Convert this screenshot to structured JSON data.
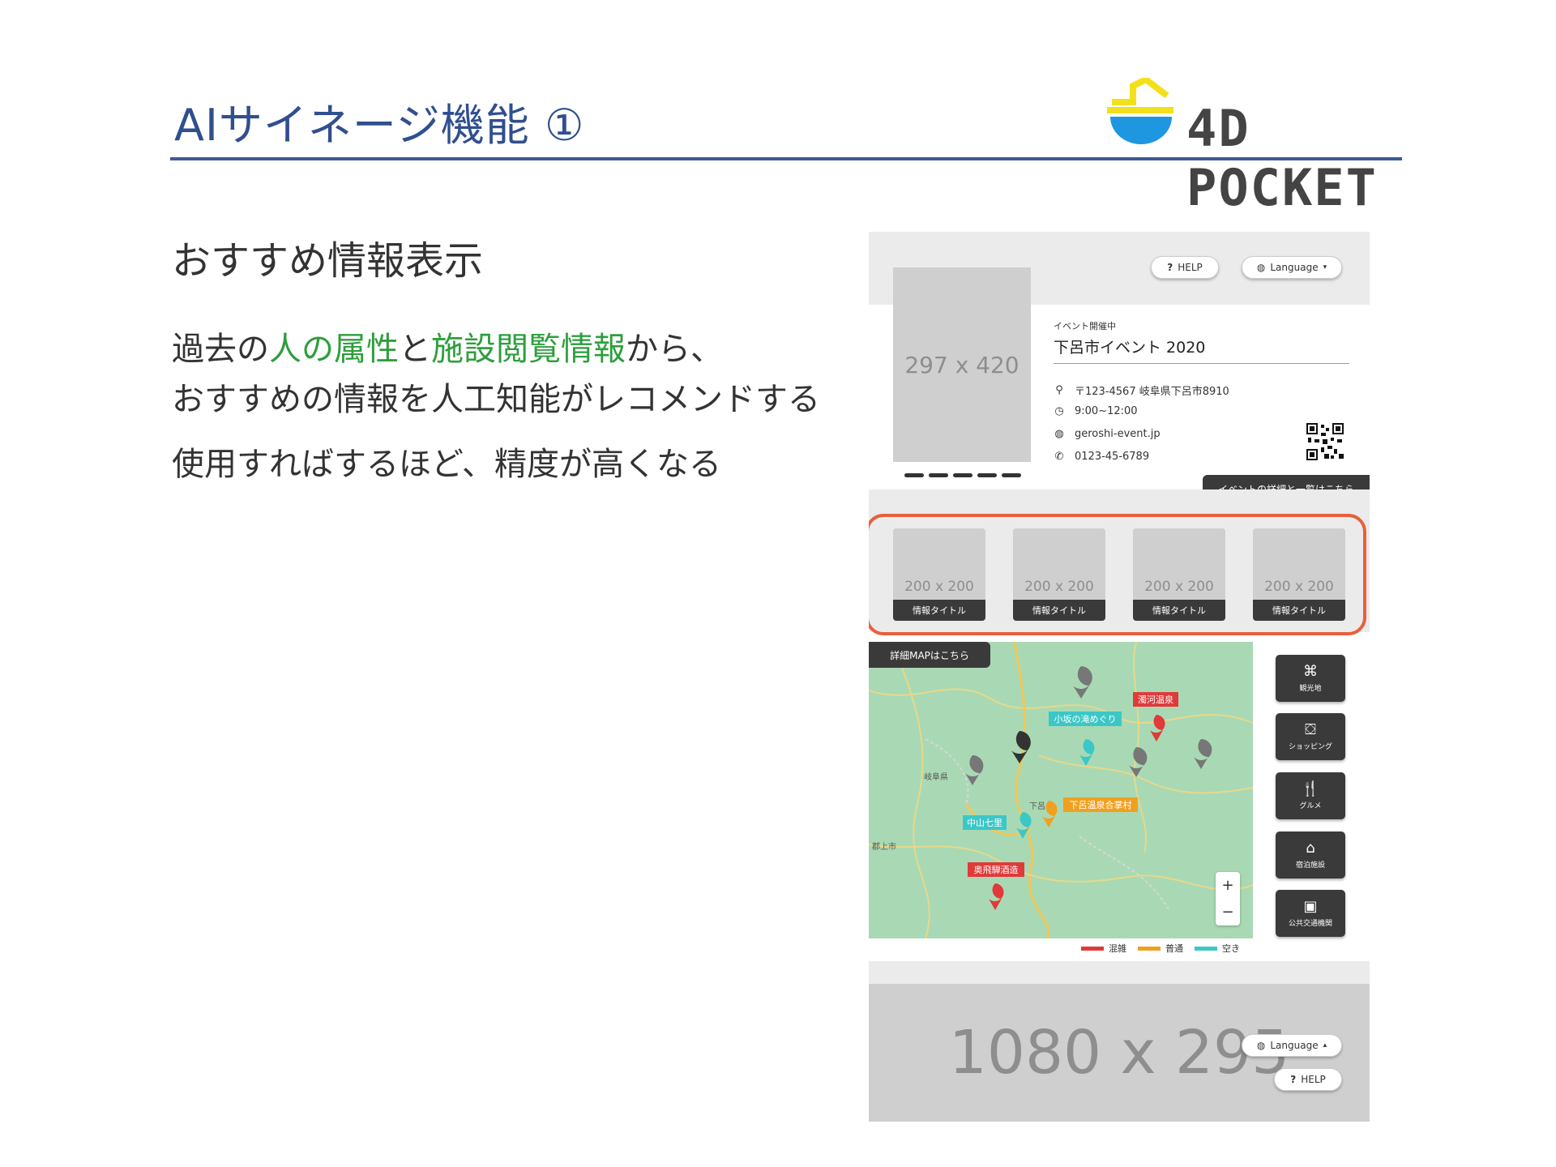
{
  "slide": {
    "title": "AIサイネージ機能 ①",
    "logo_text": "4D POCKET",
    "subheading": "おすすめ情報表示",
    "line1": {
      "p1": "過去の",
      "h1": "人の属性",
      "p2": "と",
      "h2": "施設閲覧情報",
      "p3": "から、"
    },
    "line2": "おすすめの情報を人工知能がレコメンドする",
    "line3": "使用すればするほど、精度が高くなる"
  },
  "colors": {
    "title": "#2f4f8f",
    "highlight": "#2e9e3c",
    "outline": "#e8603c",
    "crowded": "#e03a3a",
    "normal": "#f0a020",
    "vacant": "#3cc7c7"
  },
  "mockup": {
    "help_label": "HELP",
    "language_label": "Language",
    "language_caret_down": "▾",
    "language_caret_up": "▴",
    "poster_placeholder": "297 x 420",
    "event": {
      "status": "イベント開催中",
      "title": "下呂市イベント 2020",
      "address": "〒123-4567 岐阜県下呂市8910",
      "hours": "9:00~12:00",
      "website": "geroshi-event.jp",
      "phone": "0123-45-6789"
    },
    "details_button": "イベントの詳細と一覧はこちら",
    "cards": [
      {
        "placeholder": "200 x 200",
        "title": "情報タイトル"
      },
      {
        "placeholder": "200 x 200",
        "title": "情報タイトル"
      },
      {
        "placeholder": "200 x 200",
        "title": "情報タイトル"
      },
      {
        "placeholder": "200 x 200",
        "title": "情報タイトル"
      }
    ],
    "map_button": "詳細MAPはこちら",
    "map_labels": {
      "kogawa": "濁河温泉",
      "kosaka": "小坂の滝めぐり",
      "gero": "下呂温泉合掌村",
      "nakayama": "中山七里",
      "okuhida": "奥飛騨酒造",
      "gifu": "岐阜県",
      "gujo": "郡上市",
      "geroshi": "下呂"
    },
    "categories": [
      {
        "label": "観光地",
        "icon": "map-icon"
      },
      {
        "label": "ショッピング",
        "icon": "basket-icon"
      },
      {
        "label": "グルメ",
        "icon": "cutlery-icon"
      },
      {
        "label": "宿泊施設",
        "icon": "bed-icon"
      },
      {
        "label": "公共交通機関",
        "icon": "train-icon"
      }
    ],
    "zoom_in": "+",
    "zoom_out": "−",
    "legend": [
      {
        "label": "混雑",
        "color": "#e03a3a"
      },
      {
        "label": "普通",
        "color": "#f0a020"
      },
      {
        "label": "空き",
        "color": "#3cc7c7"
      }
    ],
    "footer_placeholder": "1080 x 295"
  }
}
